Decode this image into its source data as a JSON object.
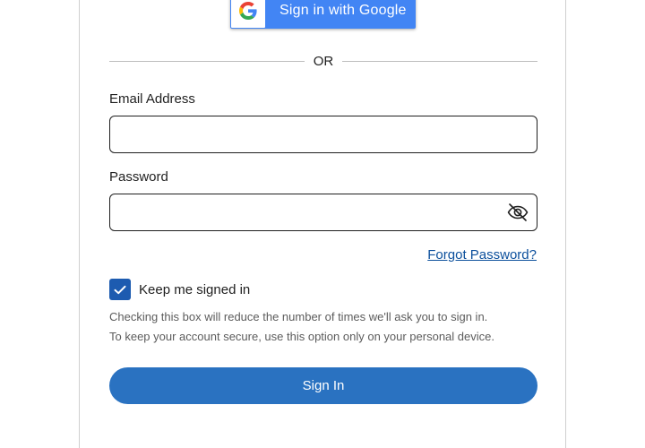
{
  "google_button": {
    "label": "Sign in with Google"
  },
  "divider": {
    "text": "OR"
  },
  "email": {
    "label": "Email Address",
    "value": "",
    "placeholder": ""
  },
  "password": {
    "label": "Password",
    "value": "",
    "placeholder": ""
  },
  "forgot_password": {
    "label": "Forgot Password?"
  },
  "keep_signed_in": {
    "label": "Keep me signed in",
    "checked": true,
    "help_line1": "Checking this box will reduce the number of times we'll ask you to sign in.",
    "help_line2": "To keep your account secure, use this option only on your personal device."
  },
  "sign_in_button": {
    "label": "Sign In"
  },
  "colors": {
    "google_blue": "#4285f4",
    "primary": "#2a72c1",
    "checkbox": "#1d5bb0",
    "link": "#0b4f9c"
  },
  "icons": {
    "google": "google-g-icon",
    "password_toggle": "eye-slash-icon",
    "checkbox": "checkmark-icon"
  }
}
